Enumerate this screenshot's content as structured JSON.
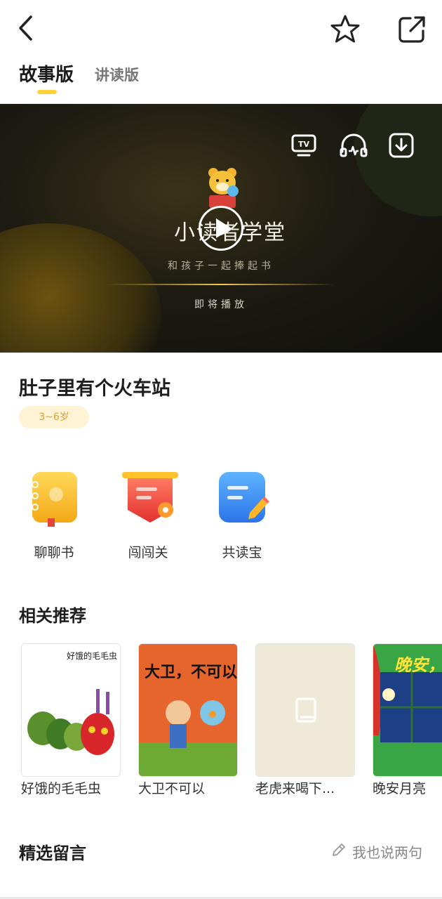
{
  "tabs": [
    {
      "label": "故事版",
      "active": true
    },
    {
      "label": "讲读版",
      "active": false
    }
  ],
  "video": {
    "brand_logo": "小读者学堂",
    "slogan": "和孩子一起捧起书",
    "status": "即将播放",
    "icons": [
      "tv-icon",
      "audio-icon",
      "download-icon"
    ]
  },
  "book": {
    "title": "肚子里有个火车站",
    "age": "3~6岁"
  },
  "features": [
    {
      "label": "聊聊书",
      "icon": "book-icon",
      "color": "#f7c02a"
    },
    {
      "label": "闯闯关",
      "icon": "flag-icon",
      "color": "#f05a4a"
    },
    {
      "label": "共读宝",
      "icon": "notepad-icon",
      "color": "#3a8ef0"
    }
  ],
  "recommend": {
    "title": "相关推荐",
    "items": [
      {
        "name": "好饿的毛毛虫",
        "cover_text": "好饿的毛毛虫"
      },
      {
        "name": "大卫不可以",
        "cover_text": "大卫，不可以"
      },
      {
        "name": "老虎来喝下...",
        "cover_text": ""
      },
      {
        "name": "晚安月亮",
        "cover_text": "晚安，月"
      }
    ]
  },
  "comments": {
    "title": "精选留言",
    "action_label": "我也说两句"
  },
  "colors": {
    "accent": "#ffd23a",
    "age_badge_bg": "#fff3d6",
    "age_badge_text": "#e0a12a"
  }
}
